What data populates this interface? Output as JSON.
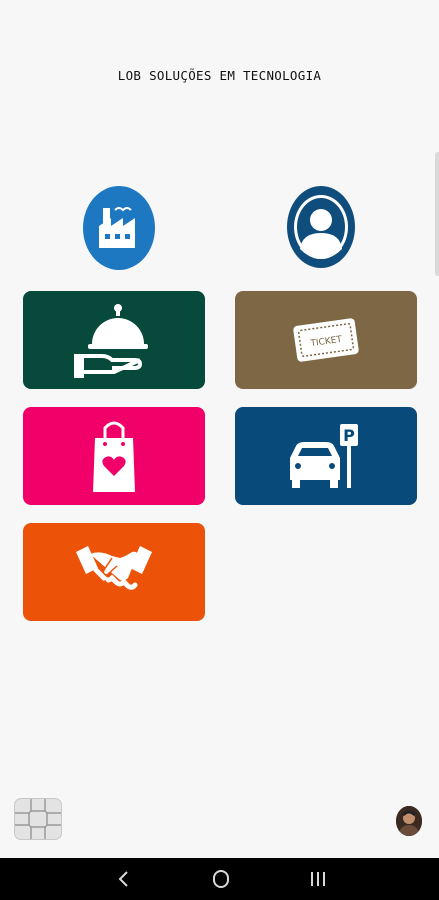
{
  "app": {
    "title": "LOB SOLUÇÕES EM TECNOLOGIA"
  },
  "top_icons": [
    {
      "name": "company",
      "icon": "factory-icon",
      "color": "#1d78c1"
    },
    {
      "name": "user",
      "icon": "user-icon",
      "color": "#0f4d7d"
    }
  ],
  "tiles": [
    {
      "name": "food-service",
      "icon": "cloche-icon",
      "color": "#07493b"
    },
    {
      "name": "ticket",
      "icon": "ticket-icon",
      "color": "#7d6744",
      "icon_text": "TICKET"
    },
    {
      "name": "shopping",
      "icon": "shopping-bag-icon",
      "color": "#f1006a"
    },
    {
      "name": "parking",
      "icon": "parking-car-icon",
      "color": "#084a79",
      "icon_text": "P"
    },
    {
      "name": "partnership",
      "icon": "handshake-icon",
      "color": "#ec5308"
    }
  ],
  "bottom": {
    "left_icon": "chip-card-icon",
    "right_icon": "avatar"
  },
  "navbar": {
    "back": "back-icon",
    "home": "home-icon",
    "recents": "recents-icon"
  }
}
